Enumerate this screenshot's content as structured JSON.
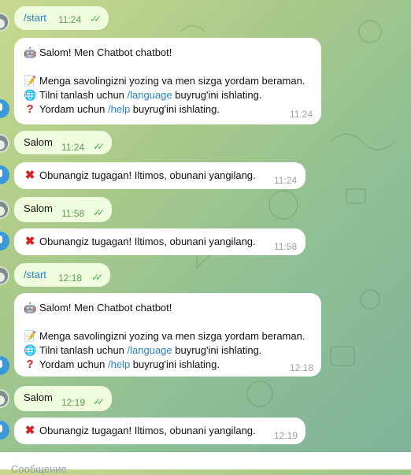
{
  "messages": [
    {
      "dir": "out",
      "text": "/start",
      "time": "11:24"
    },
    {
      "dir": "in",
      "lines": [
        {
          "icon": "robot",
          "text": "Salom! Men Chatbot  chatbot!"
        },
        {
          "icon": "memo",
          "text": "Menga savolingizni yozing va men sizga yordam beraman."
        },
        {
          "icon": "globe",
          "pre": "Tilni tanlash uchun ",
          "cmd": "/language",
          "post": " buyrug'ini ishlating."
        },
        {
          "icon": "question",
          "pre": "Yordam uchun ",
          "cmd": "/help",
          "post": " buyrug'ini ishlating."
        }
      ],
      "time": "11:24"
    },
    {
      "dir": "out",
      "text": "Salom",
      "time": "11:24"
    },
    {
      "dir": "in",
      "icon": "cross",
      "text": "Obunangiz tugagan! Iltimos, obunani yangilang.",
      "time": "11:24"
    },
    {
      "dir": "out",
      "text": "Salom",
      "time": "11:58"
    },
    {
      "dir": "in",
      "icon": "cross",
      "text": "Obunangiz tugagan! Iltimos, obunani yangilang.",
      "time": "11:58"
    },
    {
      "dir": "out",
      "text": "/start",
      "time": "12:18"
    },
    {
      "dir": "in",
      "lines": [
        {
          "icon": "robot",
          "text": "Salom! Men Chatbot  chatbot!"
        },
        {
          "icon": "memo",
          "text": "Menga savolingizni yozing va men sizga yordam beraman."
        },
        {
          "icon": "globe",
          "pre": "Tilni tanlash uchun ",
          "cmd": "/language",
          "post": " buyrug'ini ishlating."
        },
        {
          "icon": "question",
          "pre": "Yordam uchun ",
          "cmd": "/help",
          "post": " buyrug'ini ishlating."
        }
      ],
      "time": "12:18"
    },
    {
      "dir": "out",
      "text": "Salom",
      "time": "12:19"
    },
    {
      "dir": "in",
      "icon": "cross",
      "text": "Obunangiz tugagan! Iltimos, obunani yangilang.",
      "time": "12:19"
    }
  ],
  "composer": {
    "placeholder": "Сообщение"
  },
  "colors": {
    "outgoing": "#effdde",
    "incoming": "#ffffff",
    "command": "#2a81c9",
    "check": "#4fae4e"
  }
}
